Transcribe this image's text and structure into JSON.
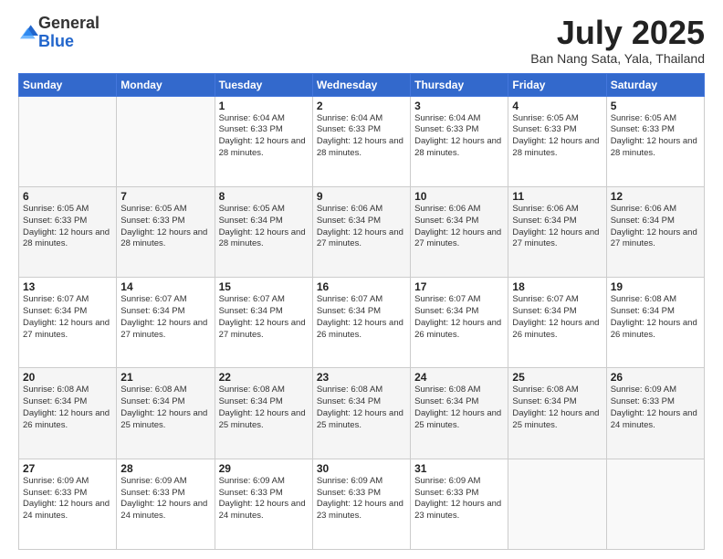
{
  "logo": {
    "general": "General",
    "blue": "Blue"
  },
  "title": "July 2025",
  "location": "Ban Nang Sata, Yala, Thailand",
  "days_of_week": [
    "Sunday",
    "Monday",
    "Tuesday",
    "Wednesday",
    "Thursday",
    "Friday",
    "Saturday"
  ],
  "weeks": [
    [
      {
        "day": null,
        "info": null
      },
      {
        "day": null,
        "info": null
      },
      {
        "day": "1",
        "sunrise": "Sunrise: 6:04 AM",
        "sunset": "Sunset: 6:33 PM",
        "daylight": "Daylight: 12 hours and 28 minutes."
      },
      {
        "day": "2",
        "sunrise": "Sunrise: 6:04 AM",
        "sunset": "Sunset: 6:33 PM",
        "daylight": "Daylight: 12 hours and 28 minutes."
      },
      {
        "day": "3",
        "sunrise": "Sunrise: 6:04 AM",
        "sunset": "Sunset: 6:33 PM",
        "daylight": "Daylight: 12 hours and 28 minutes."
      },
      {
        "day": "4",
        "sunrise": "Sunrise: 6:05 AM",
        "sunset": "Sunset: 6:33 PM",
        "daylight": "Daylight: 12 hours and 28 minutes."
      },
      {
        "day": "5",
        "sunrise": "Sunrise: 6:05 AM",
        "sunset": "Sunset: 6:33 PM",
        "daylight": "Daylight: 12 hours and 28 minutes."
      }
    ],
    [
      {
        "day": "6",
        "sunrise": "Sunrise: 6:05 AM",
        "sunset": "Sunset: 6:33 PM",
        "daylight": "Daylight: 12 hours and 28 minutes."
      },
      {
        "day": "7",
        "sunrise": "Sunrise: 6:05 AM",
        "sunset": "Sunset: 6:33 PM",
        "daylight": "Daylight: 12 hours and 28 minutes."
      },
      {
        "day": "8",
        "sunrise": "Sunrise: 6:05 AM",
        "sunset": "Sunset: 6:34 PM",
        "daylight": "Daylight: 12 hours and 28 minutes."
      },
      {
        "day": "9",
        "sunrise": "Sunrise: 6:06 AM",
        "sunset": "Sunset: 6:34 PM",
        "daylight": "Daylight: 12 hours and 27 minutes."
      },
      {
        "day": "10",
        "sunrise": "Sunrise: 6:06 AM",
        "sunset": "Sunset: 6:34 PM",
        "daylight": "Daylight: 12 hours and 27 minutes."
      },
      {
        "day": "11",
        "sunrise": "Sunrise: 6:06 AM",
        "sunset": "Sunset: 6:34 PM",
        "daylight": "Daylight: 12 hours and 27 minutes."
      },
      {
        "day": "12",
        "sunrise": "Sunrise: 6:06 AM",
        "sunset": "Sunset: 6:34 PM",
        "daylight": "Daylight: 12 hours and 27 minutes."
      }
    ],
    [
      {
        "day": "13",
        "sunrise": "Sunrise: 6:07 AM",
        "sunset": "Sunset: 6:34 PM",
        "daylight": "Daylight: 12 hours and 27 minutes."
      },
      {
        "day": "14",
        "sunrise": "Sunrise: 6:07 AM",
        "sunset": "Sunset: 6:34 PM",
        "daylight": "Daylight: 12 hours and 27 minutes."
      },
      {
        "day": "15",
        "sunrise": "Sunrise: 6:07 AM",
        "sunset": "Sunset: 6:34 PM",
        "daylight": "Daylight: 12 hours and 27 minutes."
      },
      {
        "day": "16",
        "sunrise": "Sunrise: 6:07 AM",
        "sunset": "Sunset: 6:34 PM",
        "daylight": "Daylight: 12 hours and 26 minutes."
      },
      {
        "day": "17",
        "sunrise": "Sunrise: 6:07 AM",
        "sunset": "Sunset: 6:34 PM",
        "daylight": "Daylight: 12 hours and 26 minutes."
      },
      {
        "day": "18",
        "sunrise": "Sunrise: 6:07 AM",
        "sunset": "Sunset: 6:34 PM",
        "daylight": "Daylight: 12 hours and 26 minutes."
      },
      {
        "day": "19",
        "sunrise": "Sunrise: 6:08 AM",
        "sunset": "Sunset: 6:34 PM",
        "daylight": "Daylight: 12 hours and 26 minutes."
      }
    ],
    [
      {
        "day": "20",
        "sunrise": "Sunrise: 6:08 AM",
        "sunset": "Sunset: 6:34 PM",
        "daylight": "Daylight: 12 hours and 26 minutes."
      },
      {
        "day": "21",
        "sunrise": "Sunrise: 6:08 AM",
        "sunset": "Sunset: 6:34 PM",
        "daylight": "Daylight: 12 hours and 25 minutes."
      },
      {
        "day": "22",
        "sunrise": "Sunrise: 6:08 AM",
        "sunset": "Sunset: 6:34 PM",
        "daylight": "Daylight: 12 hours and 25 minutes."
      },
      {
        "day": "23",
        "sunrise": "Sunrise: 6:08 AM",
        "sunset": "Sunset: 6:34 PM",
        "daylight": "Daylight: 12 hours and 25 minutes."
      },
      {
        "day": "24",
        "sunrise": "Sunrise: 6:08 AM",
        "sunset": "Sunset: 6:34 PM",
        "daylight": "Daylight: 12 hours and 25 minutes."
      },
      {
        "day": "25",
        "sunrise": "Sunrise: 6:08 AM",
        "sunset": "Sunset: 6:34 PM",
        "daylight": "Daylight: 12 hours and 25 minutes."
      },
      {
        "day": "26",
        "sunrise": "Sunrise: 6:09 AM",
        "sunset": "Sunset: 6:33 PM",
        "daylight": "Daylight: 12 hours and 24 minutes."
      }
    ],
    [
      {
        "day": "27",
        "sunrise": "Sunrise: 6:09 AM",
        "sunset": "Sunset: 6:33 PM",
        "daylight": "Daylight: 12 hours and 24 minutes."
      },
      {
        "day": "28",
        "sunrise": "Sunrise: 6:09 AM",
        "sunset": "Sunset: 6:33 PM",
        "daylight": "Daylight: 12 hours and 24 minutes."
      },
      {
        "day": "29",
        "sunrise": "Sunrise: 6:09 AM",
        "sunset": "Sunset: 6:33 PM",
        "daylight": "Daylight: 12 hours and 24 minutes."
      },
      {
        "day": "30",
        "sunrise": "Sunrise: 6:09 AM",
        "sunset": "Sunset: 6:33 PM",
        "daylight": "Daylight: 12 hours and 23 minutes."
      },
      {
        "day": "31",
        "sunrise": "Sunrise: 6:09 AM",
        "sunset": "Sunset: 6:33 PM",
        "daylight": "Daylight: 12 hours and 23 minutes."
      },
      {
        "day": null,
        "info": null
      },
      {
        "day": null,
        "info": null
      }
    ]
  ]
}
